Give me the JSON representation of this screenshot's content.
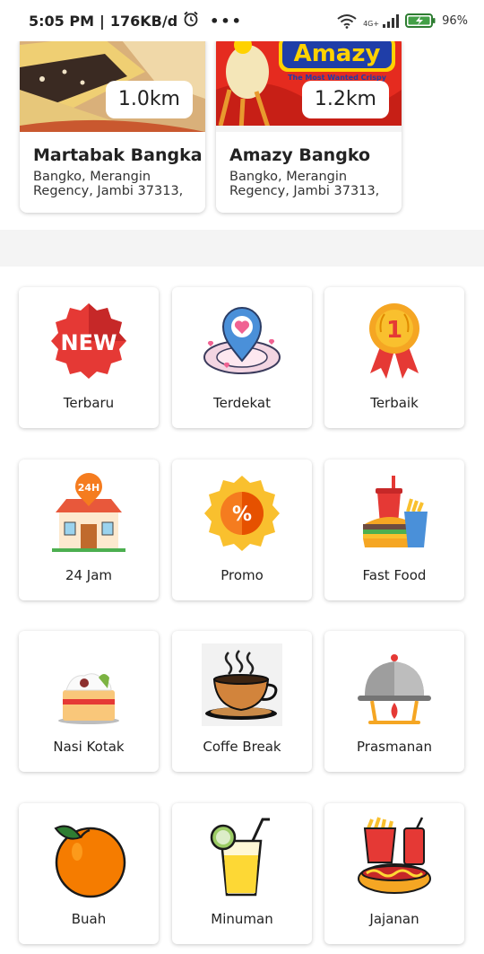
{
  "status_bar": {
    "time": "5:05 PM",
    "speed": "176KB/d",
    "network": "4G+",
    "battery": "96%"
  },
  "restaurants": [
    {
      "name": "Martabak Bangka",
      "address": "Bangko, Merangin Regency, Jambi 37313,",
      "distance": "1.0km"
    },
    {
      "name": "Amazy Bangko",
      "address": "Bangko, Merangin Regency, Jambi 37313,",
      "distance": "1.2km",
      "logo_text": "Amazy",
      "logo_tagline": "The Most Wanted Crispy"
    }
  ],
  "categories": [
    {
      "label": "Terbaru",
      "icon": "new-badge-icon"
    },
    {
      "label": "Terdekat",
      "icon": "location-pin-icon"
    },
    {
      "label": "Terbaik",
      "icon": "medal-icon"
    },
    {
      "label": "24 Jam",
      "icon": "store-24h-icon"
    },
    {
      "label": "Promo",
      "icon": "promo-badge-icon"
    },
    {
      "label": "Fast Food",
      "icon": "fast-food-icon"
    },
    {
      "label": "Nasi Kotak",
      "icon": "rice-box-icon"
    },
    {
      "label": "Coffe Break",
      "icon": "coffee-cup-icon"
    },
    {
      "label": "Prasmanan",
      "icon": "buffet-cloche-icon"
    },
    {
      "label": "Buah",
      "icon": "orange-fruit-icon"
    },
    {
      "label": "Minuman",
      "icon": "drink-icon"
    },
    {
      "label": "Jajanan",
      "icon": "snack-icon"
    }
  ],
  "icon_text": {
    "new": "NEW",
    "h24": "24H",
    "rank": "1",
    "percent": "%"
  },
  "colors": {
    "red": "#e53935",
    "orange": "#f57c1f",
    "gold": "#f9c02e",
    "blue": "#4a90d9"
  }
}
